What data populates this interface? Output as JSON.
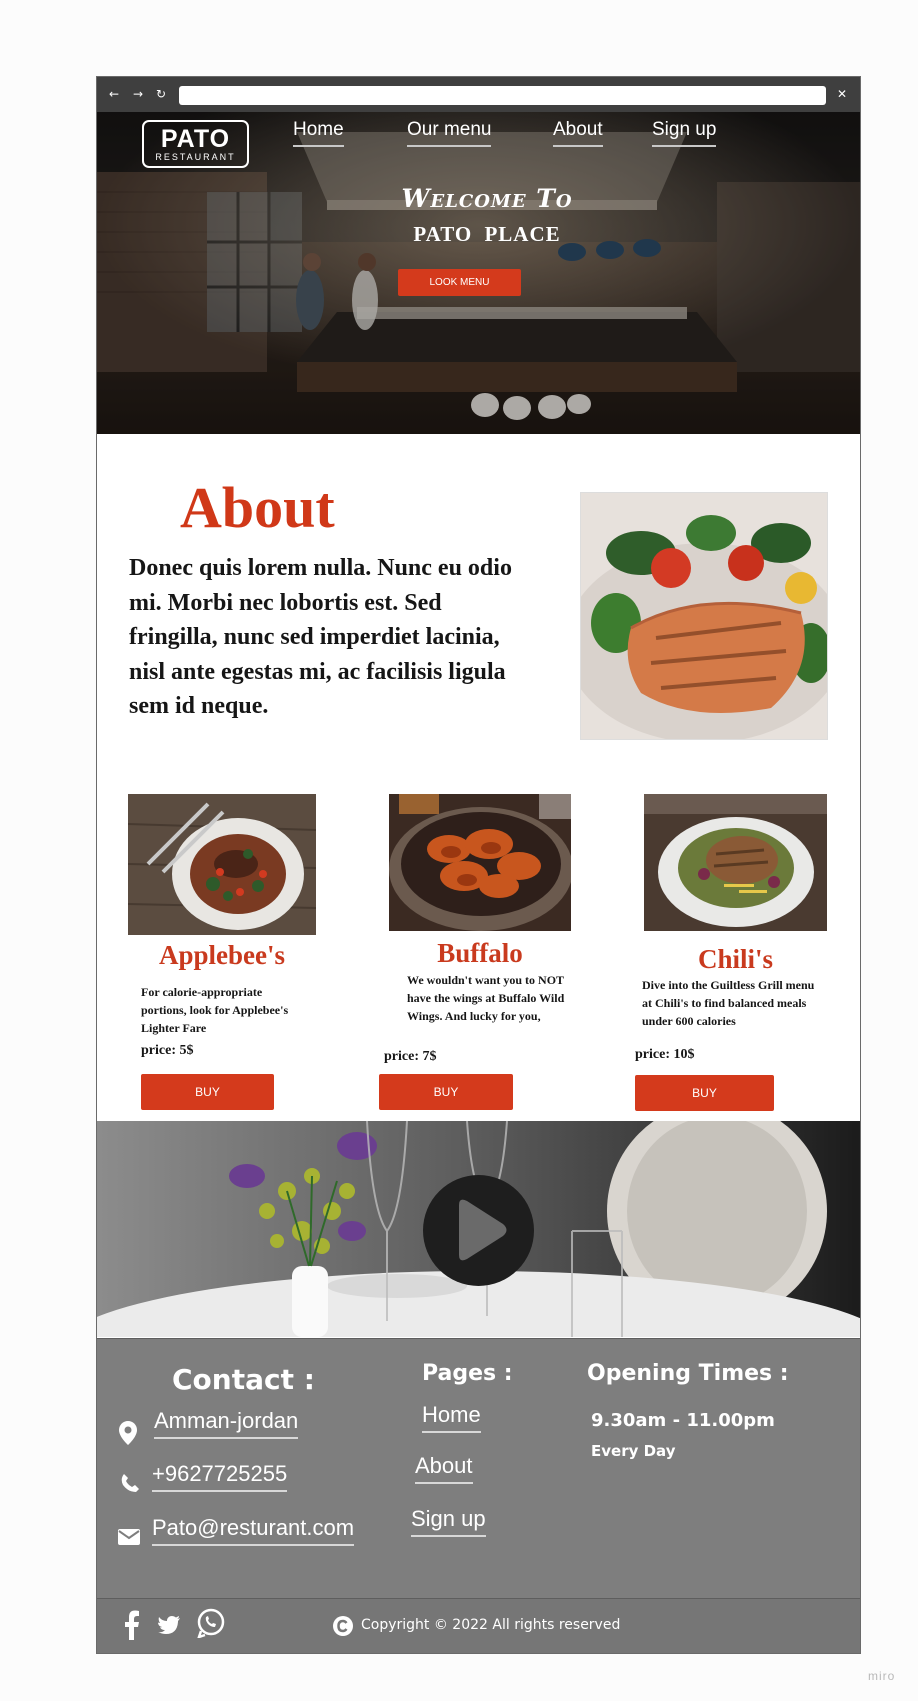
{
  "browser": {
    "back_icon": "arrow-left-icon",
    "forward_icon": "arrow-right-icon",
    "reload_icon": "reload-icon",
    "close_icon": "close-icon",
    "back_glyph": "←",
    "forward_glyph": "→",
    "reload_glyph": "↻",
    "close_glyph": "✕",
    "url": ""
  },
  "header": {
    "logo_title": "PATO",
    "logo_subtitle": "RESTAURANT",
    "nav": [
      {
        "label": "Home"
      },
      {
        "label": "Our menu"
      },
      {
        "label": "About"
      },
      {
        "label": "Sign up"
      }
    ]
  },
  "hero": {
    "welcome": "Welcome To",
    "place": "PATO PLACE",
    "cta_label": "LOOK MENU"
  },
  "about": {
    "title": "About",
    "text": "Donec quis lorem nulla. Nunc eu odio mi. Morbi nec lobortis est. Sed fringilla, nunc sed imperdiet lacinia, nisl ante egestas mi, ac facilisis ligula sem id neque."
  },
  "menu": {
    "items": [
      {
        "name": "Applebee's",
        "description": "For calorie-appropriate portions, look for Applebee's Lighter Fare",
        "price": "price: 5$",
        "buy_label": "BUY"
      },
      {
        "name": "Buffalo",
        "description": "We wouldn't want you to NOT have the wings at Buffalo Wild Wings. And lucky for you,",
        "price": "price: 7$",
        "buy_label": "BUY"
      },
      {
        "name": "Chili's",
        "description": "Dive into the Guiltless Grill menu at Chili's to find balanced meals under 600 calories",
        "price": "price: 10$",
        "buy_label": "BUY"
      }
    ]
  },
  "video": {
    "play_icon": "play-icon"
  },
  "footer": {
    "contact_title": "Contact :",
    "contact": [
      {
        "icon": "location-pin-icon",
        "text": "Amman-jordan"
      },
      {
        "icon": "phone-icon",
        "text": "+9627725255"
      },
      {
        "icon": "envelope-icon",
        "text": "Pato@resturant.com"
      }
    ],
    "pages_title": "Pages :",
    "pages": [
      {
        "label": "Home"
      },
      {
        "label": "About"
      },
      {
        "label": "Sign up"
      }
    ],
    "opening_title": "Opening Times :",
    "hours": "9.30am - 11.00pm",
    "days": "Every Day"
  },
  "bottom_bar": {
    "social": [
      "facebook-icon",
      "twitter-icon",
      "whatsapp-icon"
    ],
    "copyright": "Copyright © 2022 All rights reserved"
  },
  "watermark": "miro",
  "colors": {
    "accent": "#d43a1c",
    "footer_bg": "#7e7e7e",
    "chrome_bg": "#3f3f3f"
  }
}
